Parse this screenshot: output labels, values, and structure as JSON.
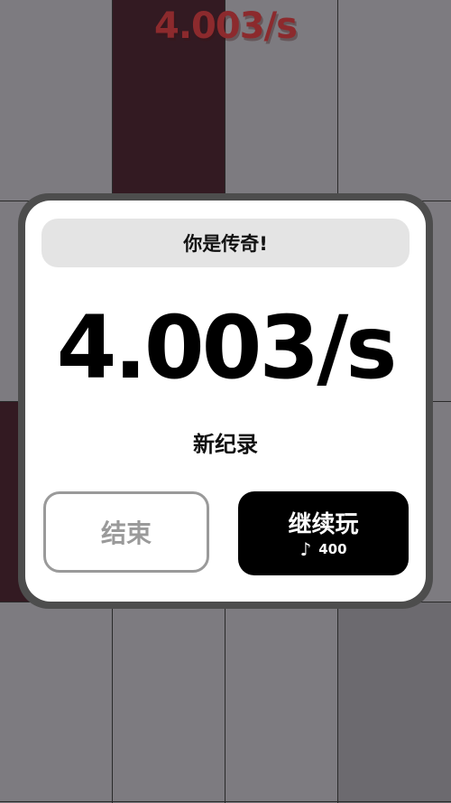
{
  "hud": {
    "score": "4.003/s"
  },
  "dialog": {
    "title": "你是传奇!",
    "score": "4.003/s",
    "record_label": "新纪录",
    "end_button": "结束",
    "continue_button": "继续玩",
    "continue_cost": "400",
    "cost_icon": "music-note-icon"
  },
  "colors": {
    "board_bg": "#7d7b80",
    "dark_tile": "#331a22",
    "score_accent": "#8c2a2d",
    "continue_bg": "#000000",
    "end_border": "#9a9a9a"
  }
}
